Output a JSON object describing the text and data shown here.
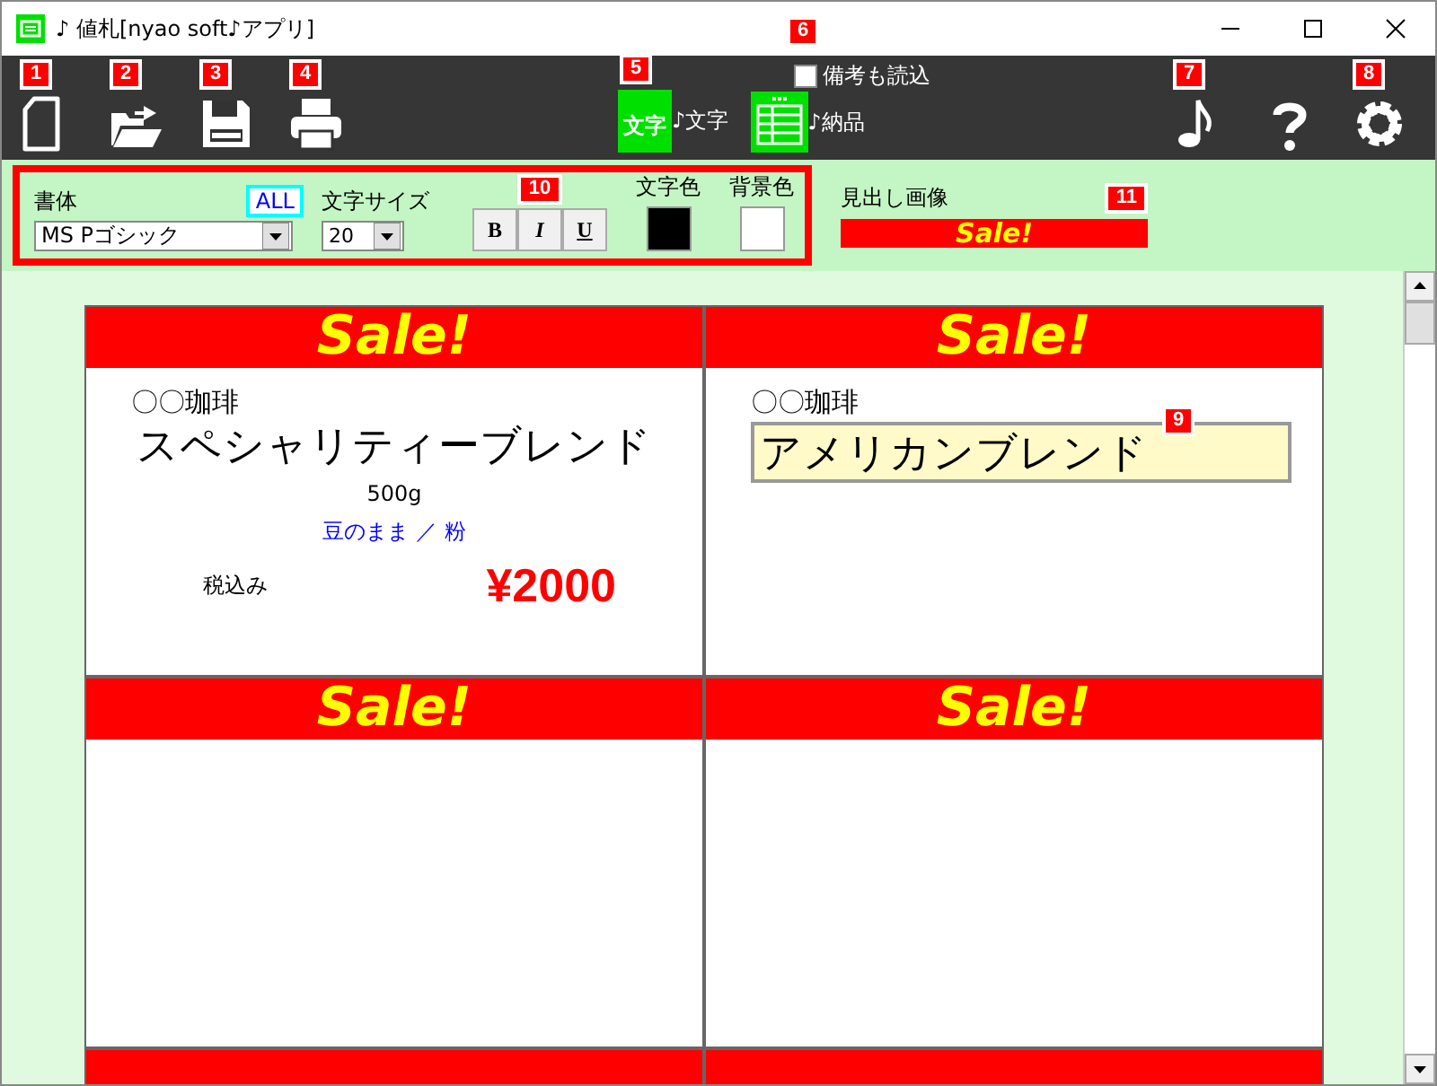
{
  "window": {
    "title": "♪ 値札[nyao soft♪アプリ]"
  },
  "toolbar": {
    "buttons": [
      {
        "kind": "new",
        "badge": "1"
      },
      {
        "kind": "open",
        "badge": "2"
      },
      {
        "kind": "save",
        "badge": "3"
      },
      {
        "kind": "print",
        "badge": "4"
      },
      {
        "kind": "text-mode",
        "icon_text": "文字",
        "label": "♪文字",
        "badge": "5"
      },
      {
        "kind": "delivery-mode",
        "label": "♪納品"
      },
      {
        "kind": "music",
        "badge": "7"
      },
      {
        "kind": "help"
      },
      {
        "kind": "settings",
        "badge": "8"
      }
    ],
    "checkbox": {
      "label": "備考も読込",
      "checked": false,
      "badge": "6"
    }
  },
  "format_bar": {
    "badge": "10",
    "font": {
      "label": "書体",
      "all_button": "ALL",
      "value": "MS Pゴシック"
    },
    "size": {
      "label": "文字サイズ",
      "value": "20"
    },
    "style_buttons": [
      {
        "kind": "bold",
        "label": "B"
      },
      {
        "kind": "italic",
        "label": "I"
      },
      {
        "kind": "underline",
        "label": "U"
      }
    ],
    "text_color": {
      "label": "文字色",
      "color": "#000000"
    },
    "background_color": {
      "label": "背景色",
      "color": "#ffffff"
    },
    "heading_image": {
      "label": "見出し画像",
      "badge": "11",
      "banner": "Sale!"
    }
  },
  "cards": [
    {
      "kind": "tag",
      "banner": "Sale!",
      "maker": "〇〇珈琲",
      "name": "スペシャリティーブレンド",
      "weight": "500g",
      "grind": "豆のまま ／ 粉",
      "tax": "税込み",
      "price": "¥2000"
    },
    {
      "kind": "tag",
      "banner": "Sale!",
      "maker": "〇〇珈琲",
      "name_field": "アメリカンブレンド",
      "badge": "9"
    },
    {
      "kind": "tag",
      "banner": "Sale!"
    },
    {
      "kind": "tag",
      "banner": "Sale!"
    },
    {
      "kind": "cut-off"
    },
    {
      "kind": "cut-off"
    }
  ]
}
